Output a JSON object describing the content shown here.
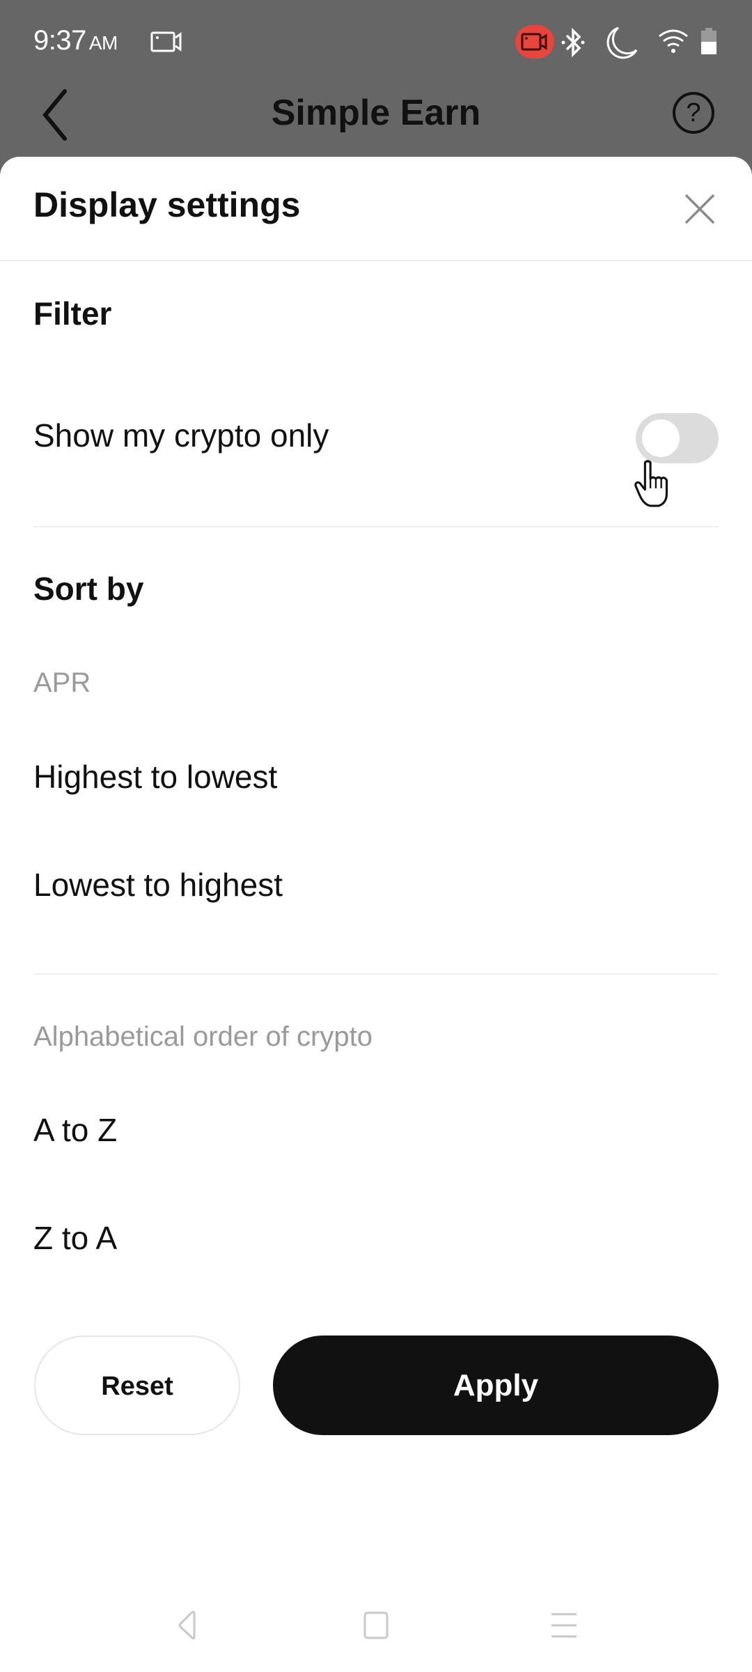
{
  "status_bar": {
    "time": "9:37",
    "ampm": "AM",
    "icons": [
      "screen-record-icon",
      "recording-active-icon",
      "bluetooth-icon",
      "do-not-disturb-moon-icon",
      "wifi-icon",
      "battery-icon"
    ],
    "record_badge_color": "#e8453c"
  },
  "app_bar": {
    "title": "Simple Earn",
    "back_icon": "chevron-left-icon",
    "help_icon": "question-circle-icon",
    "help_glyph": "?"
  },
  "sheet": {
    "title": "Display settings",
    "close_icon": "close-icon",
    "filter": {
      "title": "Filter",
      "show_my_crypto_only": {
        "label": "Show my crypto only",
        "enabled": false
      }
    },
    "sort_by": {
      "title": "Sort by",
      "groups": [
        {
          "label": "APR",
          "options": [
            "Highest to lowest",
            "Lowest to highest"
          ]
        },
        {
          "label": "Alphabetical order of crypto",
          "options": [
            "A to Z",
            "Z to A"
          ]
        }
      ]
    },
    "buttons": {
      "reset": "Reset",
      "apply": "Apply"
    }
  },
  "nav_bar": {
    "icons": [
      "back-triangle-icon",
      "home-square-icon",
      "recents-menu-icon"
    ]
  },
  "colors": {
    "primary_button": "#111111",
    "toggle_off": "#dcdcdc",
    "muted_text": "#9a9a9a",
    "scrim": "#666666"
  }
}
